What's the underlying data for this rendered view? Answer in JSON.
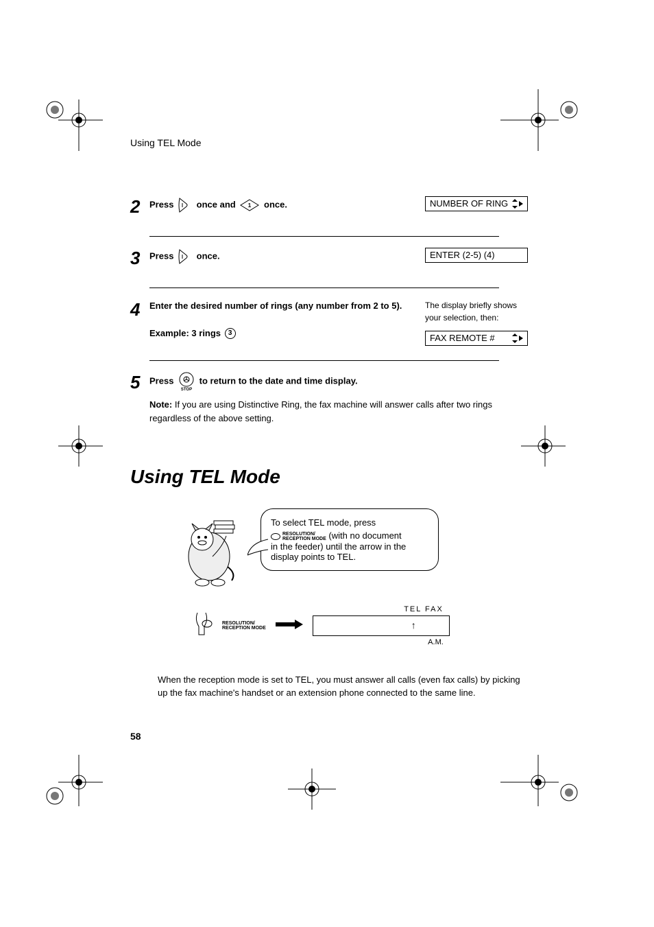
{
  "header": {
    "running_head": "Using TEL Mode"
  },
  "steps": {
    "s2": {
      "num": "2",
      "press": "Press",
      "once_and": "once and",
      "once_end": "once.",
      "display": "NUMBER OF RING"
    },
    "s3": {
      "num": "3",
      "press": "Press",
      "once": "once.",
      "display": "ENTER (2-5) (4)"
    },
    "s4": {
      "num": "4",
      "instr": "Enter the desired number of rings (any number from 2 to 5).",
      "example_label": "Example: 3 rings",
      "example_key": "3",
      "side_text": "The display briefly shows your selection, then:",
      "display": "FAX REMOTE #"
    },
    "s5": {
      "num": "5",
      "press": "Press",
      "stop_label": "STOP",
      "rest": "to return to the date and time display.",
      "note_label": "Note:",
      "note_body": "If you are using Distinctive Ring, the fax machine will answer calls after two rings regardless of the above setting."
    }
  },
  "section": {
    "title": "Using TEL Mode"
  },
  "callout": {
    "line1": "To select TEL mode, press",
    "btn_top": "RESOLUTION/",
    "btn_bot": "RECEPTION MODE",
    "line2a": "(with no document",
    "line2b": "in the feeder) until the arrow in the display points to TEL."
  },
  "mode": {
    "btn_top": "RESOLUTION/",
    "btn_bot": "RECEPTION MODE",
    "top_labels": "TEL  FAX",
    "bottom_label": "A.M.",
    "arrow_glyph": "↑"
  },
  "body_para": "When the reception mode is set to TEL, you must answer all calls (even fax calls) by picking up the fax machine's handset or an extension phone connected to the same line.",
  "page_number": "58"
}
